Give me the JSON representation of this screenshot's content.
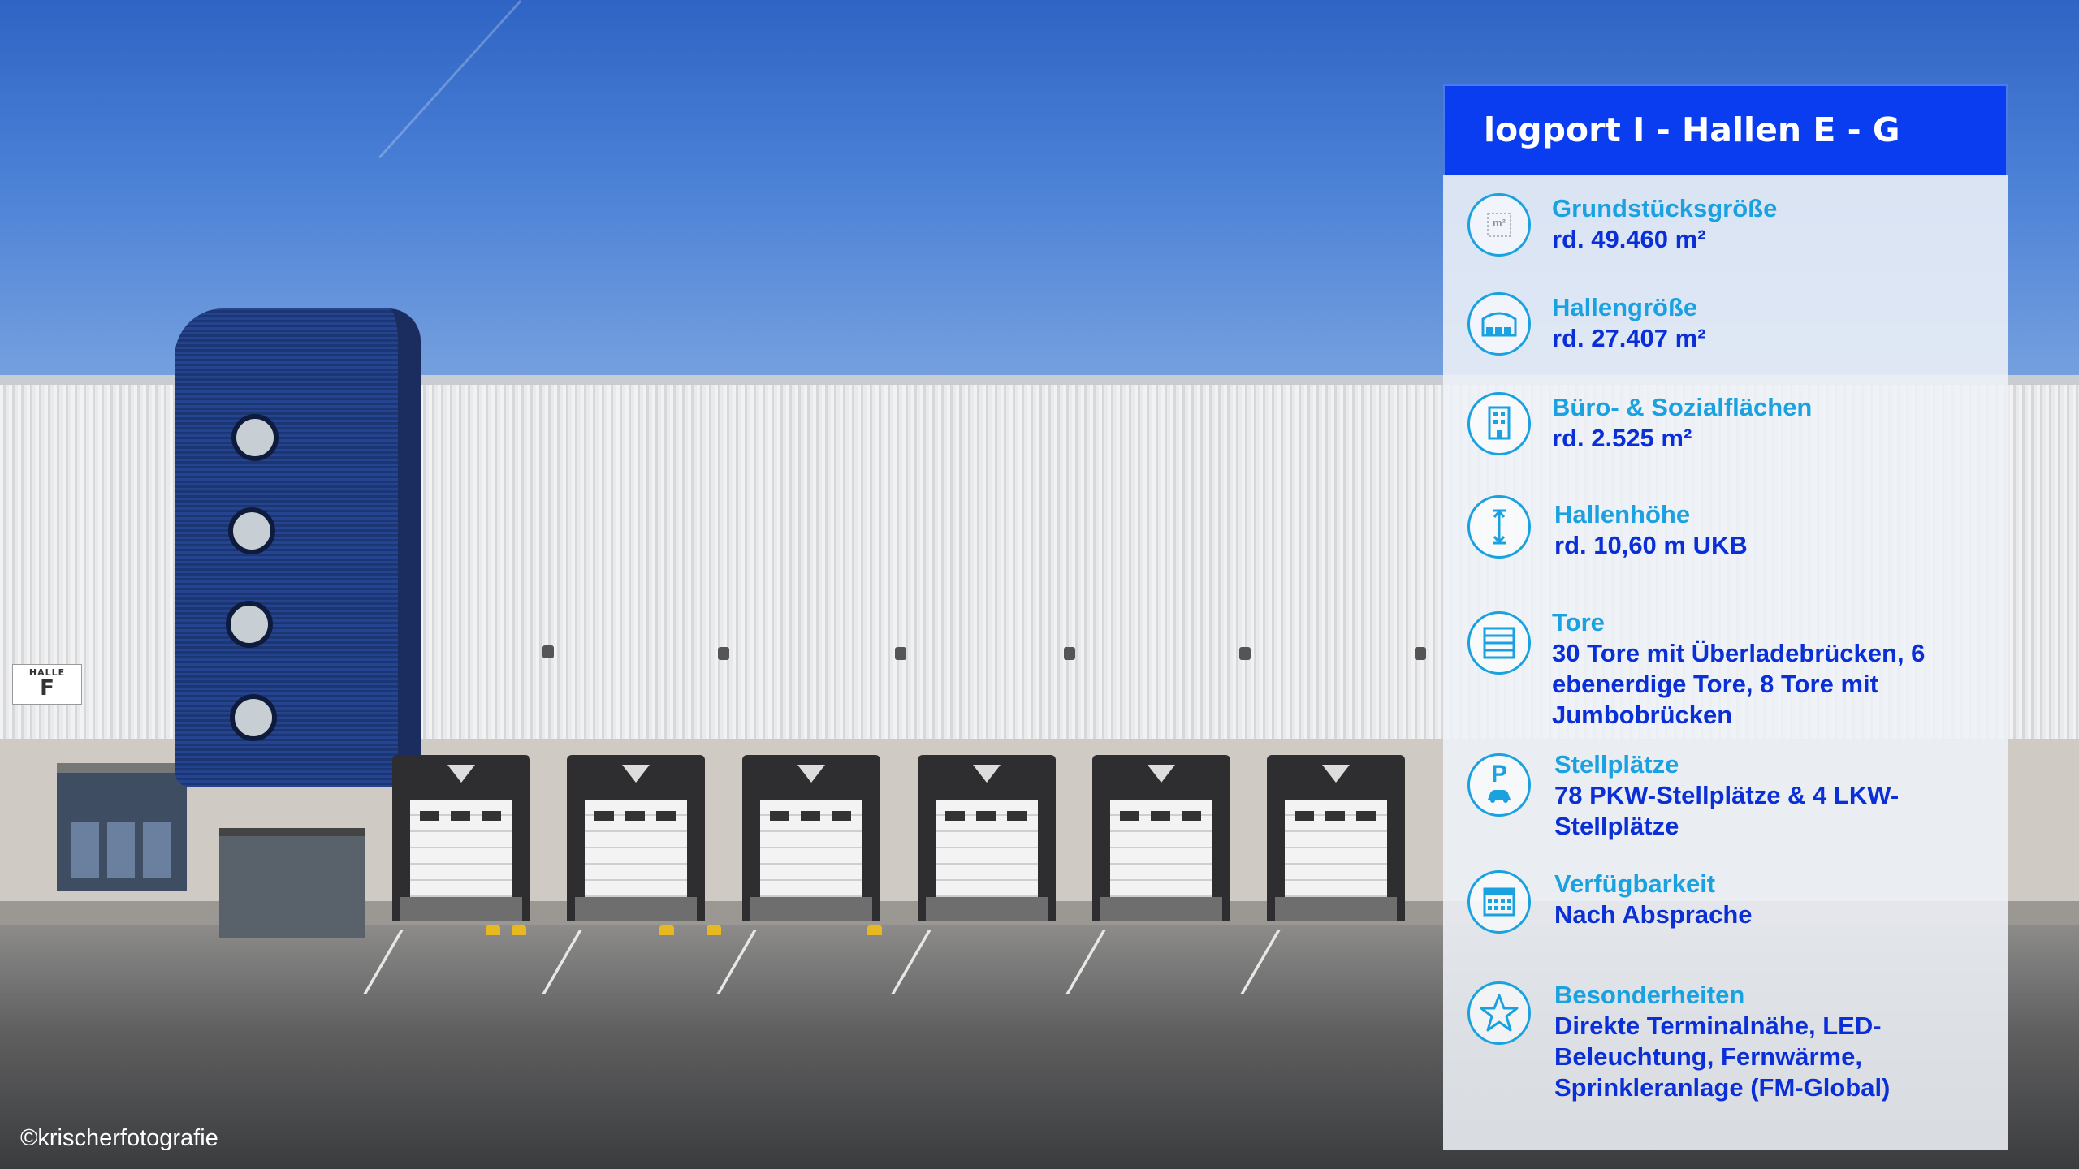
{
  "panel": {
    "title": "logport I - Hallen E - G",
    "items": [
      {
        "icon": "plot-size-icon",
        "label": "Grundstücksgröße",
        "value": "rd. 49.460 m²",
        "icon_text": "m²"
      },
      {
        "icon": "warehouse-icon",
        "label": "Hallengröße",
        "value": "rd. 27.407 m²"
      },
      {
        "icon": "office-building-icon",
        "label": "Büro- & Sozialflächen",
        "value": "rd. 2.525 m²"
      },
      {
        "icon": "height-arrow-icon",
        "label": "Hallenhöhe",
        "value": "rd. 10,60 m UKB"
      },
      {
        "icon": "gate-icon",
        "label": "Tore",
        "value": "30 Tore mit Überladebrücken, 6 ebenerdige Tore, 8 Tore mit Jumbobrücken"
      },
      {
        "icon": "parking-icon",
        "label": "Stellplätze",
        "value": "78 PKW-Stellplätze & 4 LKW-Stellplätze",
        "icon_text": "P"
      },
      {
        "icon": "calendar-icon",
        "label": "Verfügbarkeit",
        "value": "Nach Absprache"
      },
      {
        "icon": "star-icon",
        "label": "Besonderheiten",
        "value": "Direkte Terminalnähe, LED-Beleuchtung, Fernwärme, Sprinkleranlage (FM-Global)"
      }
    ]
  },
  "photo": {
    "sign_line1": "HALLE",
    "sign_line2": "F"
  },
  "credit": "©krischerfotografie",
  "colors": {
    "header_blue": "#0a3cf0",
    "label_cyan": "#1aa1df",
    "value_blue": "#0a2fd6"
  }
}
